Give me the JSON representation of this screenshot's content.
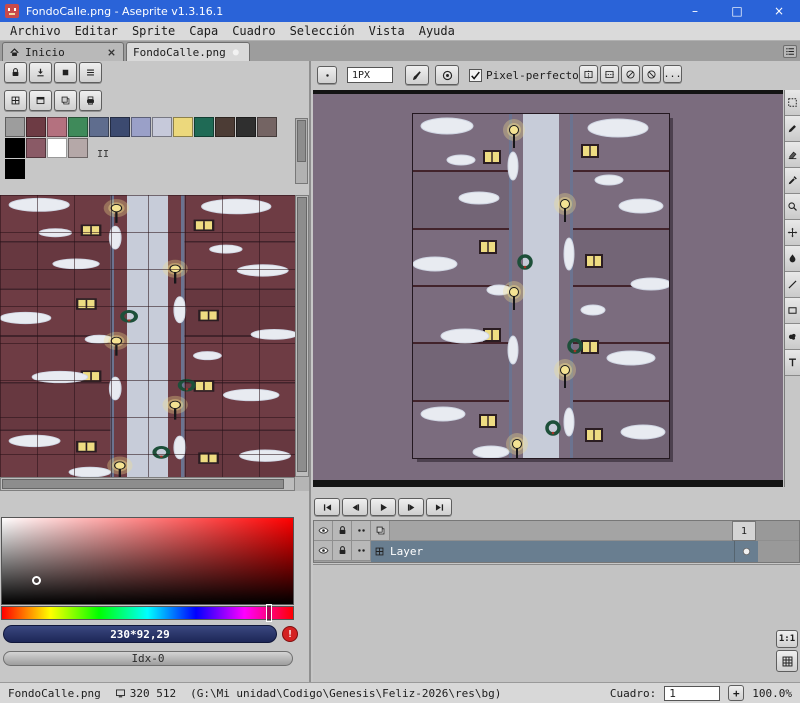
{
  "window": {
    "title": "FondoCalle.png - Aseprite v1.3.16.1",
    "minimize": "–",
    "maximize": "□",
    "close": "×"
  },
  "menu": {
    "items": [
      "Archivo",
      "Editar",
      "Sprite",
      "Capa",
      "Cuadro",
      "Selección",
      "Vista",
      "Ayuda"
    ]
  },
  "tabs": {
    "home_label": "Inicio",
    "file_label": "FondoCalle.png",
    "modified_dot": "●"
  },
  "context_bar": {
    "brush_size": "1PX",
    "pixel_perfect_label": "Pixel-perfecto"
  },
  "symmetry": {
    "buttons": [
      "sym-vertical",
      "sym-horizontal",
      "sym-diagonal-right",
      "sym-diagonal-left"
    ],
    "more_label": "..."
  },
  "left_buttons": {
    "row_a": [
      "lock",
      "arrow-down",
      "square",
      "menu"
    ],
    "row_b": [
      "grid",
      "window",
      "copy",
      "printer"
    ]
  },
  "toolbar": {
    "tools": [
      "rect-marquee",
      "pencil",
      "eraser",
      "eyedropper",
      "zoom",
      "move",
      "paint-bucket",
      "line",
      "rectangle",
      "jumble",
      "text"
    ]
  },
  "palette": {
    "row1": [
      "#9d9d9d",
      "#6d3b44",
      "#b4717f",
      "#3f8a5a",
      "#5f6d8e",
      "#3c4a70",
      "#9aa0c8",
      "#c6c9da",
      "#ecd87c",
      "#1f6a55",
      "#4c3c35",
      "#2f2f2f",
      "#746463"
    ],
    "row2": [
      "#000000",
      "#8a5a66",
      "#ffffff",
      "#b5a8a8"
    ],
    "row3": [
      "#000000"
    ],
    "marker": "II"
  },
  "color_selector": {
    "rgb_text": "230*92,29",
    "warning": "!",
    "index_text": "Idx-0"
  },
  "playback": {
    "buttons": [
      "skip-first",
      "prev-frame",
      "play",
      "next-frame",
      "skip-last"
    ]
  },
  "timeline": {
    "frame_number": "1",
    "layer_name": "Layer"
  },
  "corner": {
    "actual_size_label": "1:1"
  },
  "status_bar": {
    "filename": "FondoCalle.png",
    "sprite_size": "320 512",
    "path": "(G:\\Mi unidad\\Codigo\\Genesis\\Feliz-2026\\res\\bg)",
    "frame_label": "Cuadro:",
    "frame_value": "1",
    "add_frame": "+",
    "zoom_level": "100.0%"
  },
  "colors": {
    "titlebar_blue": "#2a63d8",
    "canvas_background": "#7b6c7e",
    "selected_row": "#697e90",
    "current_color_bar": "#1d2757",
    "brick_red": "#6e3c44",
    "road_gray": "#9099b3",
    "snow_white": "#e8ebf1"
  }
}
